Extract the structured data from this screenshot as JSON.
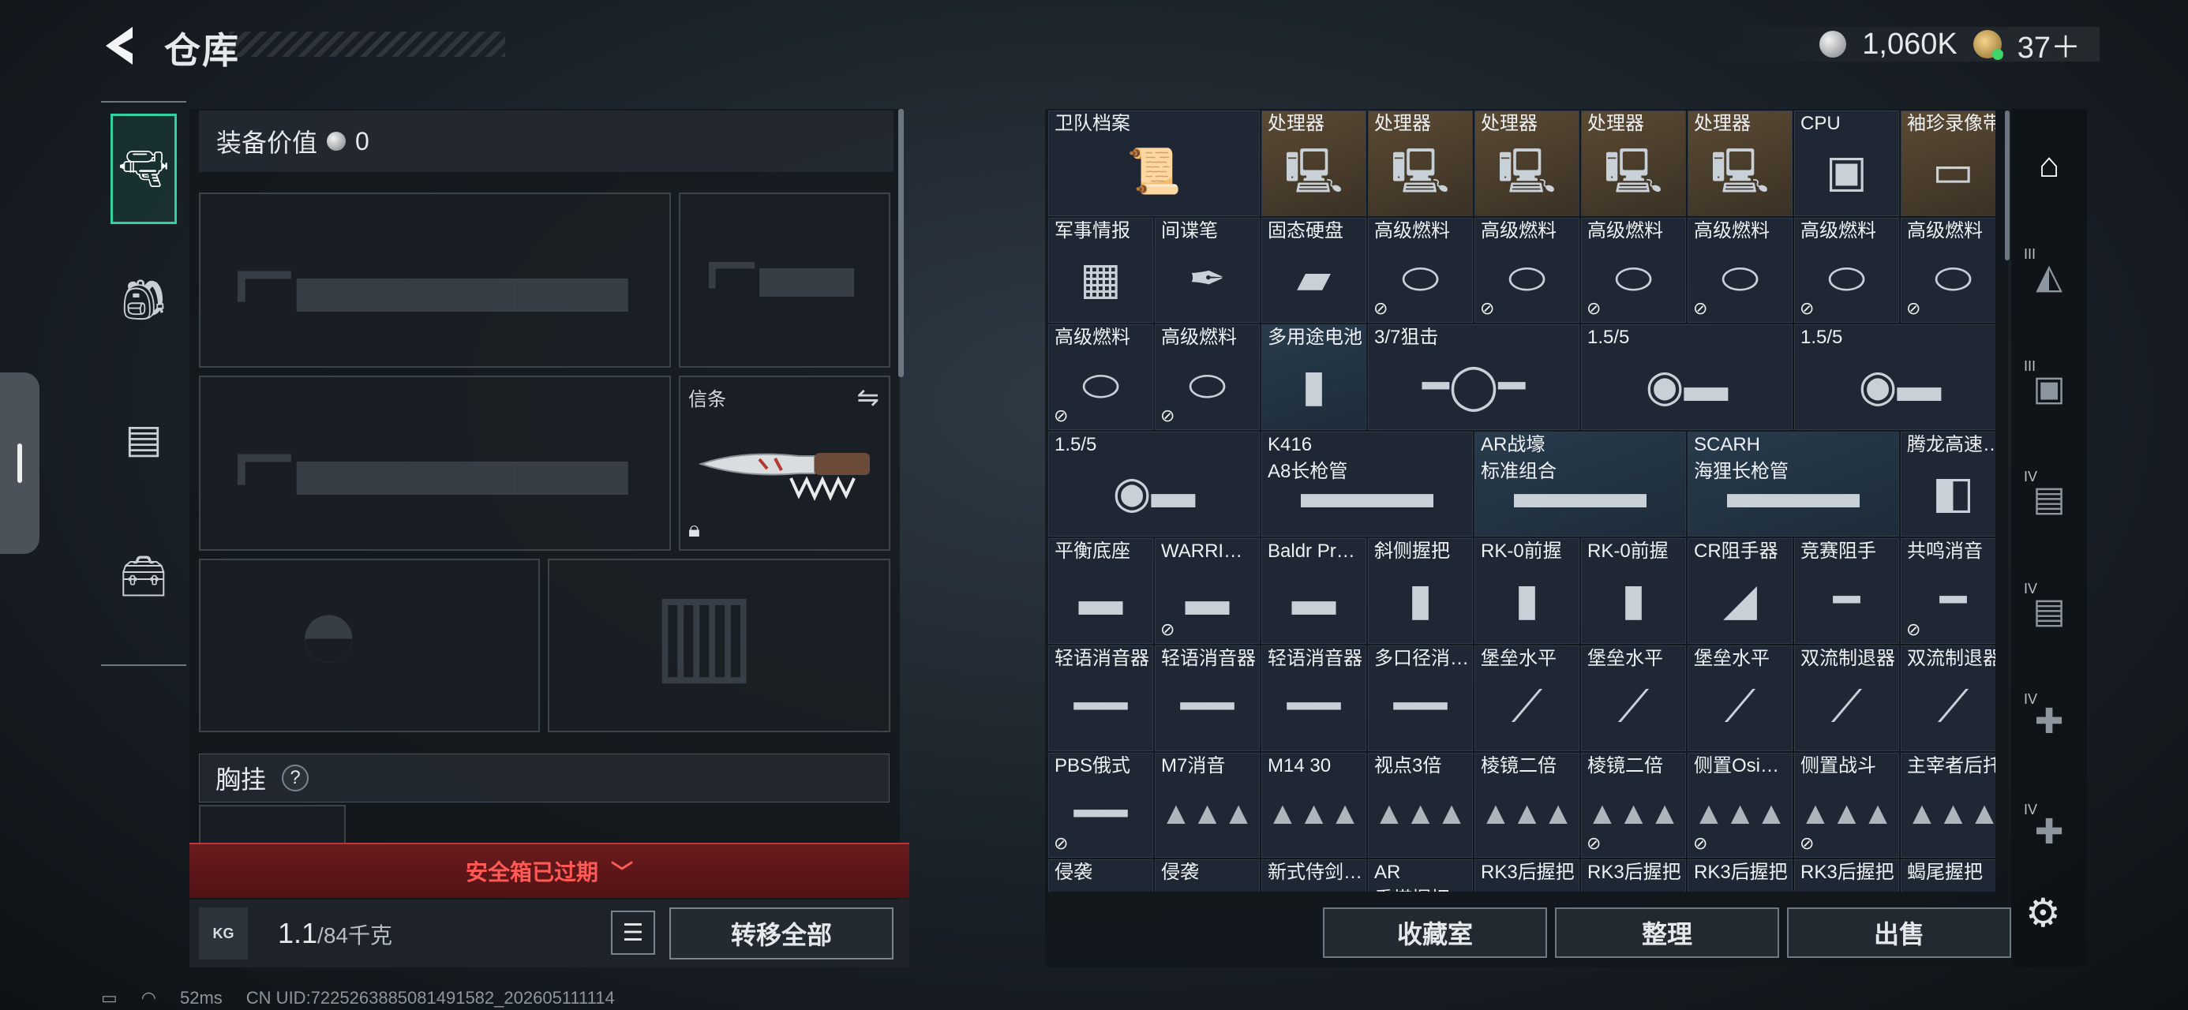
{
  "header": {
    "title": "仓库",
    "silver": "1,060K",
    "rank": "37＋"
  },
  "rail": {
    "items": [
      "pistol-icon",
      "backpack-icon",
      "vest-icon",
      "toolbox-icon"
    ]
  },
  "loadout": {
    "equip_value_label": "装备价值",
    "equip_value": "0",
    "melee_label": "信条",
    "chest_rig_label": "胸挂",
    "safe_box_expired": "安全箱已过期",
    "weight_icon_text": "KG",
    "weight": "1.1",
    "weight_max": "/84千克",
    "transfer_all": "转移全部"
  },
  "stash": {
    "cells": [
      {
        "name": "卫队档案",
        "icon": "📜",
        "style": "",
        "span": 2
      },
      {
        "name": "处理器",
        "icon": "🖳",
        "style": "gold"
      },
      {
        "name": "处理器",
        "icon": "🖳",
        "style": "gold"
      },
      {
        "name": "处理器",
        "icon": "🖳",
        "style": "gold"
      },
      {
        "name": "处理器",
        "icon": "🖳",
        "style": "gold"
      },
      {
        "name": "处理器",
        "icon": "🖳",
        "style": "gold"
      },
      {
        "name": "CPU",
        "icon": "▣",
        "style": ""
      },
      {
        "name": "袖珍录像带",
        "icon": "▭",
        "style": "gold"
      },
      {
        "name": "军事情报",
        "icon": "▦",
        "style": ""
      },
      {
        "name": "间谍笔",
        "icon": "✒",
        "style": ""
      },
      {
        "name": "固态硬盘",
        "icon": "▰",
        "style": ""
      },
      {
        "name": "高级燃料",
        "icon": "⬭",
        "style": "",
        "tag": "⊘"
      },
      {
        "name": "高级燃料",
        "icon": "⬭",
        "style": "",
        "tag": "⊘"
      },
      {
        "name": "高级燃料",
        "icon": "⬭",
        "style": "",
        "tag": "⊘"
      },
      {
        "name": "高级燃料",
        "icon": "⬭",
        "style": "",
        "tag": "⊘"
      },
      {
        "name": "高级燃料",
        "icon": "⬭",
        "style": "",
        "tag": "⊘"
      },
      {
        "name": "高级燃料",
        "icon": "⬭",
        "style": "",
        "tag": "⊘"
      },
      {
        "name": "高级燃料",
        "icon": "⬭",
        "style": "",
        "tag": "⊘"
      },
      {
        "name": "高级燃料",
        "icon": "⬭",
        "style": "",
        "tag": "⊘"
      },
      {
        "name": "多用途电池",
        "icon": "▮",
        "style": "blue"
      },
      {
        "name": "3/7狙击",
        "icon": "━◯━",
        "style": "",
        "span": 2
      },
      {
        "name": "1.5/5",
        "icon": "◉▬",
        "style": "",
        "span": 2
      },
      {
        "name": "1.5/5",
        "icon": "◉▬",
        "style": "",
        "span": 2
      },
      {
        "name": "1.5/5",
        "icon": "◉▬",
        "style": "",
        "span": 2
      },
      {
        "name": "K416",
        "sub": "A8长枪管",
        "icon": "▬▬▬",
        "style": "",
        "span": 2
      },
      {
        "name": "AR战壕",
        "sub": "标准组合",
        "icon": "▬▬▬",
        "style": "blue",
        "span": 2
      },
      {
        "name": "SCARH",
        "sub": "海狸长枪管",
        "icon": "▬▬▬",
        "style": "blue",
        "span": 2
      },
      {
        "name": "腾龙高速…",
        "icon": "◧",
        "style": ""
      },
      {
        "name": "平衡底座",
        "icon": "▬",
        "style": ""
      },
      {
        "name": "WARRIO…",
        "icon": "▬",
        "style": "",
        "tag": "⊘"
      },
      {
        "name": "Baldr Pr…",
        "icon": "▬",
        "style": ""
      },
      {
        "name": "斜侧握把",
        "icon": "▮",
        "style": ""
      },
      {
        "name": "RK-0前握",
        "icon": "▮",
        "style": ""
      },
      {
        "name": "RK-0前握",
        "icon": "▮",
        "style": ""
      },
      {
        "name": "CR阻手器",
        "icon": "◢",
        "style": ""
      },
      {
        "name": "竞赛阻手",
        "icon": "━",
        "style": ""
      },
      {
        "name": "共鸣消音",
        "icon": "━",
        "style": "",
        "tag": "⊘"
      },
      {
        "name": "轻语消音器",
        "icon": "━━",
        "style": ""
      },
      {
        "name": "轻语消音器",
        "icon": "━━",
        "style": ""
      },
      {
        "name": "轻语消音器",
        "icon": "━━",
        "style": ""
      },
      {
        "name": "多口径消…",
        "icon": "━━",
        "style": ""
      },
      {
        "name": "堡垒水平",
        "icon": "⟋",
        "style": ""
      },
      {
        "name": "堡垒水平",
        "icon": "⟋",
        "style": ""
      },
      {
        "name": "堡垒水平",
        "icon": "⟋",
        "style": ""
      },
      {
        "name": "双流制退器",
        "icon": "⟋",
        "style": ""
      },
      {
        "name": "双流制退器",
        "icon": "⟋",
        "style": ""
      },
      {
        "name": "PBS俄式",
        "icon": "━━",
        "style": "",
        "tag": "⊘"
      },
      {
        "name": "M7消音",
        "icon": "▲▲▲",
        "style": "",
        "unknown": true
      },
      {
        "name": "M14 30",
        "icon": "▲▲▲",
        "style": "",
        "unknown": true
      },
      {
        "name": "视点3倍",
        "icon": "▲▲▲",
        "style": "",
        "unknown": true
      },
      {
        "name": "棱镜二倍",
        "icon": "▲▲▲",
        "style": "",
        "unknown": true
      },
      {
        "name": "棱镜二倍",
        "icon": "▲▲▲",
        "style": "",
        "unknown": true,
        "tag": "⊘"
      },
      {
        "name": "侧置Osig…",
        "icon": "▲▲▲",
        "style": "",
        "unknown": true,
        "tag": "⊘"
      },
      {
        "name": "侧置战斗",
        "icon": "▲▲▲",
        "style": "",
        "unknown": true,
        "tag": "⊘"
      },
      {
        "name": "主宰者后托",
        "icon": "▲▲▲",
        "style": "",
        "unknown": true
      },
      {
        "name": "侵袭",
        "icon": "▲",
        "style": "",
        "unknown": true
      },
      {
        "name": "侵袭",
        "icon": "▲",
        "style": "",
        "unknown": true
      },
      {
        "name": "新式侍剑…",
        "icon": "▲",
        "style": "",
        "unknown": true
      },
      {
        "name": "AR",
        "sub": "重塔握把",
        "icon": "",
        "style": "",
        "unknown": true
      },
      {
        "name": "RK3后握把",
        "icon": "▲",
        "style": "",
        "unknown": true
      },
      {
        "name": "RK3后握把",
        "icon": "▲",
        "style": "",
        "unknown": true
      },
      {
        "name": "RK3后握把",
        "icon": "▲",
        "style": "",
        "unknown": true
      },
      {
        "name": "RK3后握把",
        "icon": "▲",
        "style": "",
        "unknown": true
      },
      {
        "name": "蝎尾握把",
        "icon": "▲",
        "style": "",
        "unknown": true
      }
    ],
    "buttons": {
      "collection": "收藏室",
      "sort": "整理",
      "sell": "出售"
    }
  },
  "filters": [
    {
      "label": "",
      "icon": "home-filter-icon",
      "glyph": "⌂",
      "active": true
    },
    {
      "label": "III",
      "icon": "tier3-filter-icon",
      "glyph": "◭",
      "active": false
    },
    {
      "label": "III",
      "icon": "tier3b-filter-icon",
      "glyph": "▣",
      "active": false
    },
    {
      "label": "IV",
      "icon": "tier4-filter-icon",
      "glyph": "▤",
      "active": false
    },
    {
      "label": "IV",
      "icon": "tier4b-filter-icon",
      "glyph": "▤",
      "active": false
    },
    {
      "label": "IV",
      "icon": "tier4-add-icon",
      "glyph": "✚",
      "active": false
    },
    {
      "label": "IV",
      "icon": "tier4-add2-icon",
      "glyph": "✚",
      "active": false
    }
  ],
  "status": {
    "ping": "52ms",
    "uid": "CN UID:7225263885081491582_202605111114"
  }
}
